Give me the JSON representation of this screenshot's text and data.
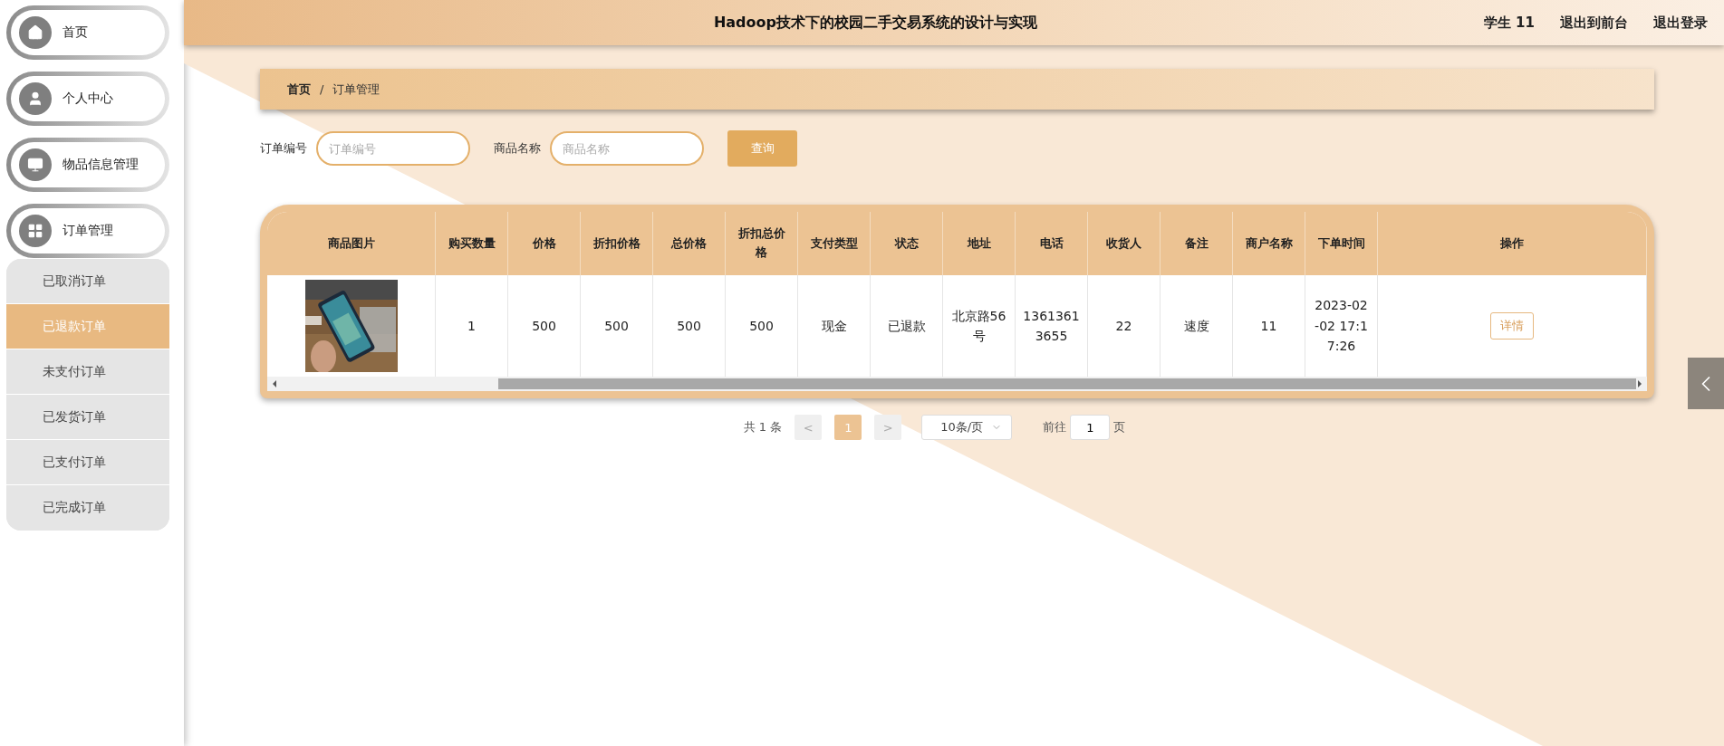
{
  "sidebar": {
    "items": [
      {
        "label": "首页",
        "selected": false
      },
      {
        "label": "个人中心",
        "selected": false
      },
      {
        "label": "物品信息管理",
        "selected": false
      },
      {
        "label": "订单管理",
        "selected": false,
        "expanded": true,
        "children": [
          {
            "label": "已取消订单",
            "selected": false
          },
          {
            "label": "已退款订单",
            "selected": true
          },
          {
            "label": "未支付订单",
            "selected": false
          },
          {
            "label": "已发货订单",
            "selected": false
          },
          {
            "label": "已支付订单",
            "selected": false
          },
          {
            "label": "已完成订单",
            "selected": false
          }
        ]
      }
    ]
  },
  "header": {
    "title": "Hadoop技术下的校园二手交易系统的设计与实现",
    "user": "学生 11",
    "links": [
      "退出到前台",
      "退出登录"
    ]
  },
  "breadcrumb": [
    "首页",
    "订单管理"
  ],
  "breadcrumb_separator": "/",
  "search": {
    "fields": [
      {
        "label": "订单编号",
        "placeholder": "订单编号"
      },
      {
        "label": "商品名称",
        "placeholder": "商品名称"
      }
    ],
    "button": "查询"
  },
  "table": {
    "columns": [
      "商品图片",
      "购买数量",
      "价格",
      "折扣价格",
      "总价格",
      "折扣总价格",
      "支付类型",
      "状态",
      "地址",
      "电话",
      "收货人",
      "备注",
      "商户名称",
      "下单时间",
      "操作"
    ],
    "rows": [
      {
        "cells": [
          {
            "kind": "picture"
          },
          "1",
          "500",
          "500",
          "500",
          "500",
          "现金",
          "已退款",
          "北京路56号",
          "13613613655",
          "22",
          "速度",
          "11",
          "2023-02-02 17:17:26"
        ],
        "action": "详情"
      }
    ]
  },
  "pagination": {
    "total": "共 1 条",
    "prev": "<",
    "pages": [
      {
        "label": "1",
        "selected": true
      }
    ],
    "next": ">",
    "page_size": "10条/页",
    "goto": "前往",
    "goto_value": "1",
    "goto_suffix": "页"
  }
}
